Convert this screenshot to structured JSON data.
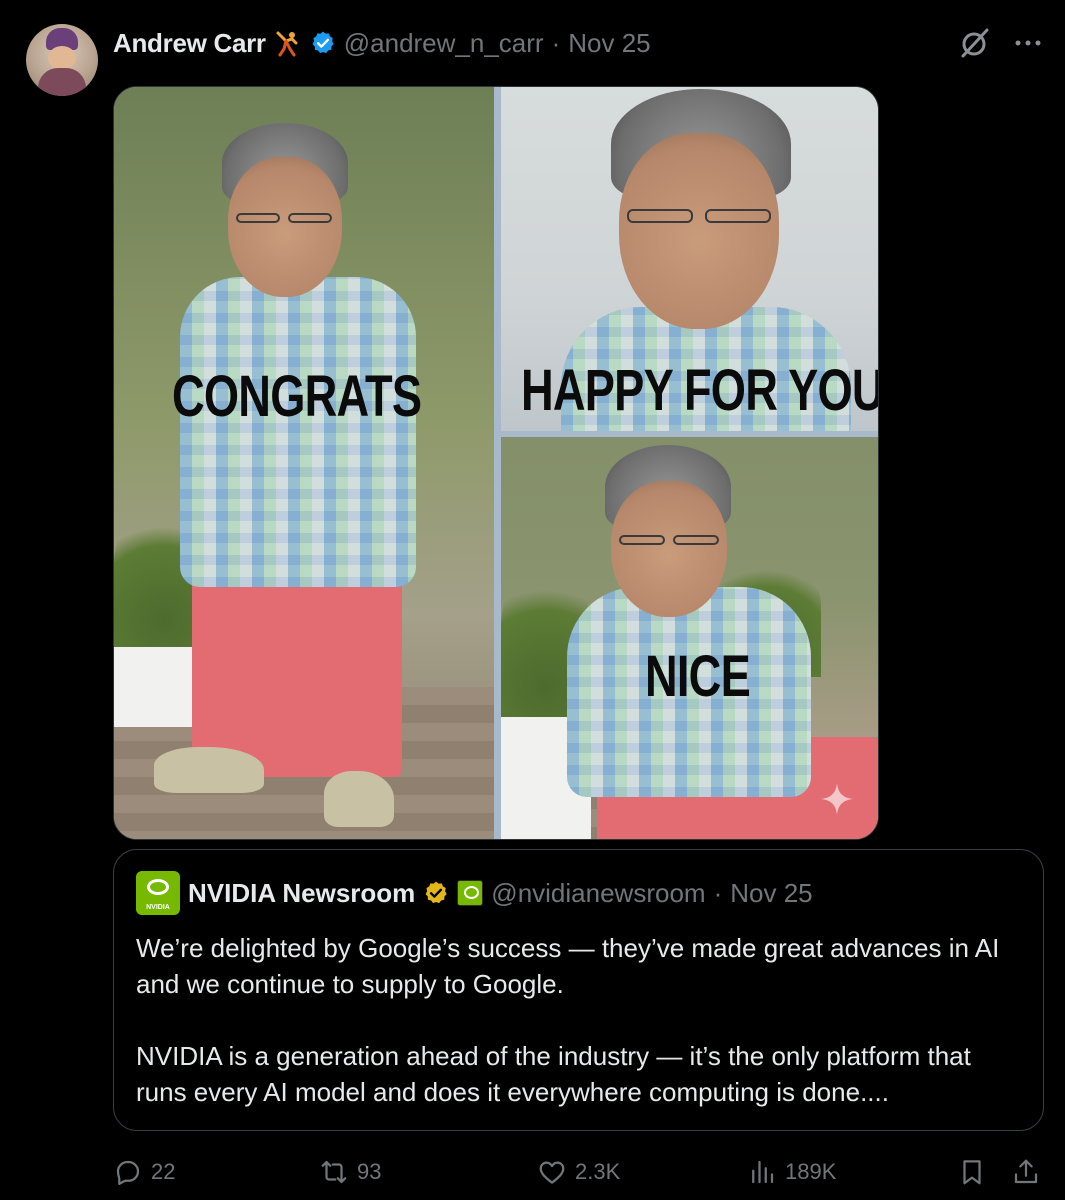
{
  "post": {
    "author_name": "Andrew Carr",
    "author_handle": "@andrew_n_carr",
    "separator": "·",
    "date": "Nov 25"
  },
  "media": {
    "captions": [
      "CONGRATS",
      "HAPPY FOR YOU",
      "NICE"
    ]
  },
  "quote": {
    "author_name": "NVIDIA Newsroom",
    "avatar_text": "NVIDIA",
    "author_handle": "@nvidianewsroom",
    "separator": "·",
    "date": "Nov 25",
    "paragraph1": "We’re delighted by Google’s success — they’ve made great advances in AI and we continue to supply to Google.",
    "paragraph2": "NVIDIA is a generation ahead of the industry — it’s the only platform that runs every AI model and does it everywhere computing is done...."
  },
  "actions": {
    "replies": "22",
    "reposts": "93",
    "likes": "2.3K",
    "views": "189K"
  },
  "colors": {
    "background": "#000000",
    "text_primary": "#e7e9ea",
    "text_secondary": "#71767b",
    "verified_blue": "#1d9bf0",
    "verified_gold": "#e2b719",
    "nvidia_green": "#76b900",
    "border": "#3a3f44"
  },
  "icons": [
    "dancer-emoji-icon",
    "verified-icon",
    "grok-icon",
    "more-icon",
    "nvidia-logo-icon",
    "gold-verified-icon",
    "affiliate-badge-icon",
    "reply-icon",
    "repost-icon",
    "like-icon",
    "views-icon",
    "bookmark-icon",
    "share-icon",
    "sparkle-icon"
  ]
}
